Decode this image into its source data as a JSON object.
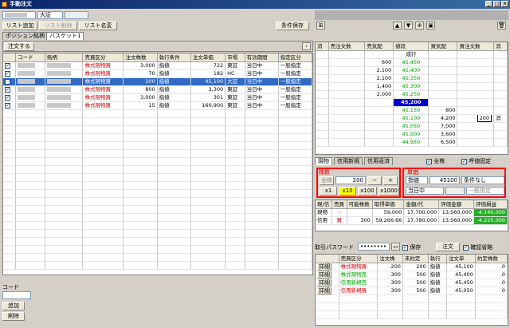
{
  "window": {
    "title": "手動注文"
  },
  "toolbar": {
    "market_select": "大証",
    "save_button": "条件保存"
  },
  "list_buttons": {
    "add": "リスト追加",
    "delete": "リスト削除",
    "rename": "リスト名変"
  },
  "tabs": {
    "position": "ポジション銘柄",
    "basket": "バスケット1"
  },
  "order_button": "注文する",
  "orders": {
    "headers": [
      "",
      "コード",
      "銘柄",
      "売買区分",
      "注文株数",
      "執行条件",
      "注文単価",
      "市場",
      "有効期間",
      "指定区分"
    ],
    "rows": [
      {
        "side": "株式現物買",
        "qty": "3,000",
        "cond": "指値",
        "price": "722",
        "market": "東証",
        "period": "当日中",
        "type": "一般指定"
      },
      {
        "side": "株式現物買",
        "qty": "70",
        "cond": "指値",
        "price": "182",
        "market": "HC",
        "period": "当日中",
        "type": "一般指定"
      },
      {
        "side": "株式現物買",
        "qty": "200",
        "cond": "指値",
        "price": "45,100",
        "market": "大証",
        "period": "当日中",
        "type": "一般指定"
      },
      {
        "side": "株式現物買",
        "qty": "800",
        "cond": "指値",
        "price": "3,300",
        "market": "東証",
        "period": "当日中",
        "type": "一般指定"
      },
      {
        "side": "株式現物買",
        "qty": "3,000",
        "cond": "指値",
        "price": "301",
        "market": "東証",
        "period": "当日中",
        "type": "一般指定"
      },
      {
        "side": "株式現物買",
        "qty": "15",
        "cond": "指値",
        "price": "160,900",
        "market": "東証",
        "period": "当日中",
        "type": "一般指定"
      }
    ]
  },
  "code_panel": {
    "label": "コード",
    "add": "追加",
    "delete": "削除"
  },
  "board": {
    "headers": [
      "消",
      "売注文数",
      "売気配",
      "値段",
      "買気配",
      "買注文数",
      "消"
    ],
    "market_label": "成行",
    "rows": [
      {
        "sell": "600",
        "price": "45,450",
        "buy": ""
      },
      {
        "sell": "2,100",
        "price": "45,400",
        "buy": ""
      },
      {
        "sell": "2,100",
        "price": "45,350",
        "buy": ""
      },
      {
        "sell": "1,400",
        "price": "45,300",
        "buy": ""
      },
      {
        "sell": "2,000",
        "price": "45,250",
        "buy": ""
      },
      {
        "sell": "",
        "price": "45,200",
        "buy": ""
      },
      {
        "sell": "",
        "price": "45,150",
        "buy": "800"
      },
      {
        "sell": "",
        "price": "45,100",
        "buy": "4,200"
      },
      {
        "sell": "",
        "price": "45,050",
        "buy": "7,000"
      },
      {
        "sell": "",
        "price": "45,000",
        "buy": "3,600"
      },
      {
        "sell": "",
        "price": "44,950",
        "buy": "6,500"
      }
    ],
    "my_order": "200",
    "my_order_cancel": "消"
  },
  "order_tabs": {
    "genbutsu": "現物",
    "shinyo_new": "信用新規",
    "shinyo_close": "信用返済",
    "all_qty": "全株",
    "fix_price": "呼値固定"
  },
  "qty_panel": {
    "label": "株数",
    "all": "全株",
    "value": "200",
    "minus": "−",
    "plus": "+",
    "x1": "x1",
    "x10": "x10",
    "x100": "x100",
    "x1000": "x1000"
  },
  "price_panel": {
    "label": "単価",
    "cond": "指値",
    "value": "45100",
    "no_cond": "条件なし",
    "period": "当日中",
    "type": "一般指定"
  },
  "position": {
    "headers": [
      "現/信",
      "売買",
      "可能株数",
      "取得単価",
      "金額/代",
      "評価金額",
      "評価損益"
    ],
    "rows": [
      {
        "kind": "現物",
        "side": "-",
        "qty": "",
        "cost": "59,000",
        "amount": "17,700,000",
        "val": "13,560,000",
        "pl": "-4,140,000"
      },
      {
        "kind": "信用",
        "side": "買",
        "qty": "300",
        "cost": "59,266.66",
        "amount": "17,780,000",
        "val": "13,560,000",
        "pl": "-4,220,000"
      }
    ]
  },
  "password": {
    "label": "取引パスワード",
    "value": "••••••••",
    "save": "保存",
    "order": "注文",
    "confirm": "確認省略"
  },
  "history": {
    "headers": [
      "",
      "売買区分",
      "注文株",
      "未約定",
      "執行",
      "注文単",
      "約定株数"
    ],
    "detail": "詳細",
    "rows": [
      {
        "side": "株式現物買",
        "cls": "red",
        "qty": "200",
        "rem": "200",
        "cond": "指値",
        "price": "45,100",
        "done": "0"
      },
      {
        "side": "株式現物売",
        "cls": "grn",
        "qty": "300",
        "rem": "500",
        "cond": "指値",
        "price": "45,400",
        "done": "0"
      },
      {
        "side": "信用新規売",
        "cls": "grn",
        "qty": "300",
        "rem": "500",
        "cond": "指値",
        "price": "45,450",
        "done": "0"
      },
      {
        "side": "信用新規買",
        "cls": "red",
        "qty": "300",
        "rem": "500",
        "cond": "指値",
        "price": "45,050",
        "done": "0"
      }
    ]
  }
}
